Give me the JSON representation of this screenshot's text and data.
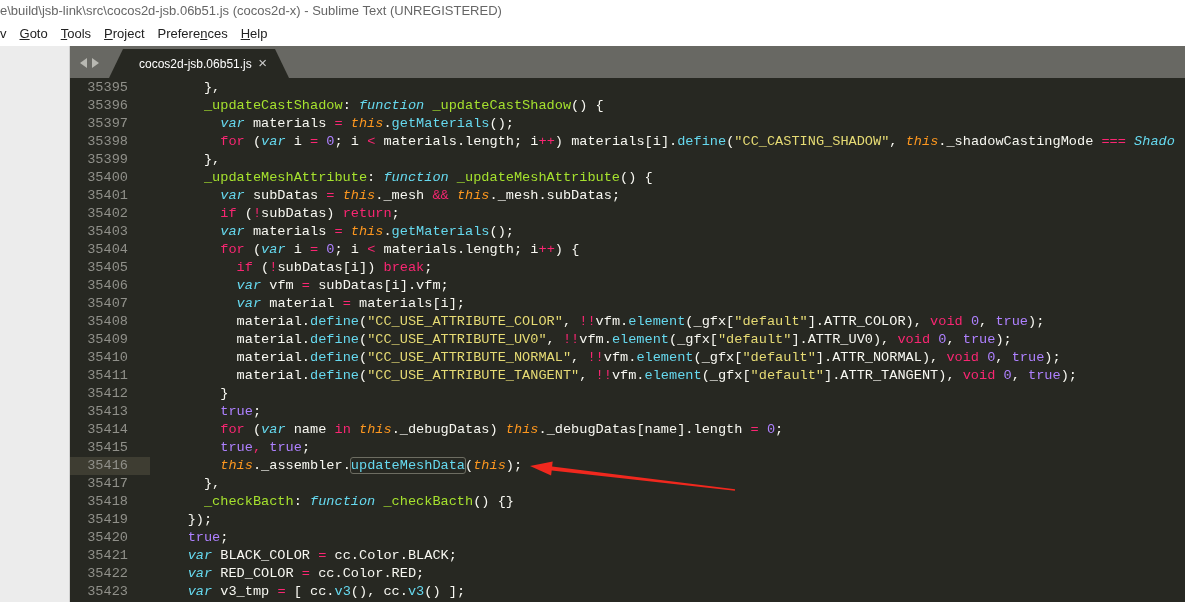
{
  "window": {
    "title": "e\\build\\jsb-link\\src\\cocos2d-jsb.06b51.js (cocos2d-x) - Sublime Text (UNREGISTERED)"
  },
  "menu": [
    {
      "before": "v"
    },
    {
      "key": "G",
      "after": "oto"
    },
    {
      "key": "T",
      "after": "ools"
    },
    {
      "key": "P",
      "after": "roject"
    },
    {
      "before": "Prefere",
      "key": "n",
      "after": "ces"
    },
    {
      "key": "H",
      "after": "elp"
    }
  ],
  "tabs": [
    {
      "label": "cocos2d-jsb.06b51.js",
      "selected": true,
      "close": "×"
    }
  ],
  "lines": [
    {
      "number": "35395",
      "current": false,
      "tokens": [
        {
          "kind": "p",
          "text": "      },"
        }
      ]
    },
    {
      "number": "35396",
      "current": false,
      "tokens": [
        {
          "kind": "en",
          "text": "      _updateCastShadow"
        },
        {
          "kind": "p",
          "text": ": "
        },
        {
          "kind": "st",
          "text": "function "
        },
        {
          "kind": "en",
          "text": "_updateCastShadow"
        },
        {
          "kind": "p",
          "text": "() {"
        }
      ]
    },
    {
      "number": "35397",
      "current": false,
      "tokens": [
        {
          "kind": "st",
          "text": "        var"
        },
        {
          "kind": "p",
          "text": " materials "
        },
        {
          "kind": "kw",
          "text": "= "
        },
        {
          "kind": "th",
          "text": "this"
        },
        {
          "kind": "p",
          "text": "."
        },
        {
          "kind": "fn",
          "text": "getMaterials"
        },
        {
          "kind": "p",
          "text": "();"
        }
      ]
    },
    {
      "number": "35398",
      "current": false,
      "tokens": [
        {
          "kind": "kw",
          "text": "        for"
        },
        {
          "kind": "p",
          "text": " ("
        },
        {
          "kind": "st",
          "text": "var"
        },
        {
          "kind": "p",
          "text": " i "
        },
        {
          "kind": "kw",
          "text": "= "
        },
        {
          "kind": "num",
          "text": "0"
        },
        {
          "kind": "p",
          "text": "; i "
        },
        {
          "kind": "kw",
          "text": "<"
        },
        {
          "kind": "p",
          "text": " materials.length; i"
        },
        {
          "kind": "kw",
          "text": "++"
        },
        {
          "kind": "p",
          "text": ") materials[i]."
        },
        {
          "kind": "fn",
          "text": "define"
        },
        {
          "kind": "p",
          "text": "("
        },
        {
          "kind": "str",
          "text": "\"CC_CASTING_SHADOW\""
        },
        {
          "kind": "p",
          "text": ", "
        },
        {
          "kind": "th",
          "text": "this"
        },
        {
          "kind": "p",
          "text": "._shadowCastingMode "
        },
        {
          "kind": "kw",
          "text": "=== "
        },
        {
          "kind": "st",
          "text": "Shado"
        }
      ]
    },
    {
      "number": "35399",
      "current": false,
      "tokens": [
        {
          "kind": "p",
          "text": "      },"
        }
      ]
    },
    {
      "number": "35400",
      "current": false,
      "tokens": [
        {
          "kind": "en",
          "text": "      _updateMeshAttribute"
        },
        {
          "kind": "p",
          "text": ": "
        },
        {
          "kind": "st",
          "text": "function "
        },
        {
          "kind": "en",
          "text": "_updateMeshAttribute"
        },
        {
          "kind": "p",
          "text": "() {"
        }
      ]
    },
    {
      "number": "35401",
      "current": false,
      "tokens": [
        {
          "kind": "st",
          "text": "        var"
        },
        {
          "kind": "p",
          "text": " subDatas "
        },
        {
          "kind": "kw",
          "text": "= "
        },
        {
          "kind": "th",
          "text": "this"
        },
        {
          "kind": "p",
          "text": "._mesh "
        },
        {
          "kind": "kw",
          "text": "&& "
        },
        {
          "kind": "th",
          "text": "this"
        },
        {
          "kind": "p",
          "text": "._mesh.subDatas;"
        }
      ]
    },
    {
      "number": "35402",
      "current": false,
      "tokens": [
        {
          "kind": "kw",
          "text": "        if"
        },
        {
          "kind": "p",
          "text": " ("
        },
        {
          "kind": "kw",
          "text": "!"
        },
        {
          "kind": "p",
          "text": "subDatas) "
        },
        {
          "kind": "kw",
          "text": "return"
        },
        {
          "kind": "p",
          "text": ";"
        }
      ]
    },
    {
      "number": "35403",
      "current": false,
      "tokens": [
        {
          "kind": "st",
          "text": "        var"
        },
        {
          "kind": "p",
          "text": " materials "
        },
        {
          "kind": "kw",
          "text": "= "
        },
        {
          "kind": "th",
          "text": "this"
        },
        {
          "kind": "p",
          "text": "."
        },
        {
          "kind": "fn",
          "text": "getMaterials"
        },
        {
          "kind": "p",
          "text": "();"
        }
      ]
    },
    {
      "number": "35404",
      "current": false,
      "tokens": [
        {
          "kind": "kw",
          "text": "        for"
        },
        {
          "kind": "p",
          "text": " ("
        },
        {
          "kind": "st",
          "text": "var"
        },
        {
          "kind": "p",
          "text": " i "
        },
        {
          "kind": "kw",
          "text": "= "
        },
        {
          "kind": "num",
          "text": "0"
        },
        {
          "kind": "p",
          "text": "; i "
        },
        {
          "kind": "kw",
          "text": "<"
        },
        {
          "kind": "p",
          "text": " materials.length; i"
        },
        {
          "kind": "kw",
          "text": "++"
        },
        {
          "kind": "p",
          "text": ") {"
        }
      ]
    },
    {
      "number": "35405",
      "current": false,
      "tokens": [
        {
          "kind": "kw",
          "text": "          if"
        },
        {
          "kind": "p",
          "text": " ("
        },
        {
          "kind": "kw",
          "text": "!"
        },
        {
          "kind": "p",
          "text": "subDatas[i]) "
        },
        {
          "kind": "kw",
          "text": "break"
        },
        {
          "kind": "p",
          "text": ";"
        }
      ]
    },
    {
      "number": "35406",
      "current": false,
      "tokens": [
        {
          "kind": "st",
          "text": "          var"
        },
        {
          "kind": "p",
          "text": " vfm "
        },
        {
          "kind": "kw",
          "text": "="
        },
        {
          "kind": "p",
          "text": " subDatas[i].vfm;"
        }
      ]
    },
    {
      "number": "35407",
      "current": false,
      "tokens": [
        {
          "kind": "st",
          "text": "          var"
        },
        {
          "kind": "p",
          "text": " material "
        },
        {
          "kind": "kw",
          "text": "="
        },
        {
          "kind": "p",
          "text": " materials[i];"
        }
      ]
    },
    {
      "number": "35408",
      "current": false,
      "tokens": [
        {
          "kind": "p",
          "text": "          material."
        },
        {
          "kind": "fn",
          "text": "define"
        },
        {
          "kind": "p",
          "text": "("
        },
        {
          "kind": "str",
          "text": "\"CC_USE_ATTRIBUTE_COLOR\""
        },
        {
          "kind": "p",
          "text": ", "
        },
        {
          "kind": "kw",
          "text": "!!"
        },
        {
          "kind": "p",
          "text": "vfm."
        },
        {
          "kind": "fn",
          "text": "element"
        },
        {
          "kind": "p",
          "text": "(_gfx["
        },
        {
          "kind": "str",
          "text": "\"default\""
        },
        {
          "kind": "p",
          "text": "].ATTR_COLOR), "
        },
        {
          "kind": "kw",
          "text": "void "
        },
        {
          "kind": "num",
          "text": "0"
        },
        {
          "kind": "p",
          "text": ", "
        },
        {
          "kind": "num",
          "text": "true"
        },
        {
          "kind": "p",
          "text": ");"
        }
      ]
    },
    {
      "number": "35409",
      "current": false,
      "tokens": [
        {
          "kind": "p",
          "text": "          material."
        },
        {
          "kind": "fn",
          "text": "define"
        },
        {
          "kind": "p",
          "text": "("
        },
        {
          "kind": "str",
          "text": "\"CC_USE_ATTRIBUTE_UV0\""
        },
        {
          "kind": "p",
          "text": ", "
        },
        {
          "kind": "kw",
          "text": "!!"
        },
        {
          "kind": "p",
          "text": "vfm."
        },
        {
          "kind": "fn",
          "text": "element"
        },
        {
          "kind": "p",
          "text": "(_gfx["
        },
        {
          "kind": "str",
          "text": "\"default\""
        },
        {
          "kind": "p",
          "text": "].ATTR_UV0), "
        },
        {
          "kind": "kw",
          "text": "void "
        },
        {
          "kind": "num",
          "text": "0"
        },
        {
          "kind": "p",
          "text": ", "
        },
        {
          "kind": "num",
          "text": "true"
        },
        {
          "kind": "p",
          "text": ");"
        }
      ]
    },
    {
      "number": "35410",
      "current": false,
      "tokens": [
        {
          "kind": "p",
          "text": "          material."
        },
        {
          "kind": "fn",
          "text": "define"
        },
        {
          "kind": "p",
          "text": "("
        },
        {
          "kind": "str",
          "text": "\"CC_USE_ATTRIBUTE_NORMAL\""
        },
        {
          "kind": "p",
          "text": ", "
        },
        {
          "kind": "kw",
          "text": "!!"
        },
        {
          "kind": "p",
          "text": "vfm."
        },
        {
          "kind": "fn",
          "text": "element"
        },
        {
          "kind": "p",
          "text": "(_gfx["
        },
        {
          "kind": "str",
          "text": "\"default\""
        },
        {
          "kind": "p",
          "text": "].ATTR_NORMAL), "
        },
        {
          "kind": "kw",
          "text": "void "
        },
        {
          "kind": "num",
          "text": "0"
        },
        {
          "kind": "p",
          "text": ", "
        },
        {
          "kind": "num",
          "text": "true"
        },
        {
          "kind": "p",
          "text": ");"
        }
      ]
    },
    {
      "number": "35411",
      "current": false,
      "tokens": [
        {
          "kind": "p",
          "text": "          material."
        },
        {
          "kind": "fn",
          "text": "define"
        },
        {
          "kind": "p",
          "text": "("
        },
        {
          "kind": "str",
          "text": "\"CC_USE_ATTRIBUTE_TANGENT\""
        },
        {
          "kind": "p",
          "text": ", "
        },
        {
          "kind": "kw",
          "text": "!!"
        },
        {
          "kind": "p",
          "text": "vfm."
        },
        {
          "kind": "fn",
          "text": "element"
        },
        {
          "kind": "p",
          "text": "(_gfx["
        },
        {
          "kind": "str",
          "text": "\"default\""
        },
        {
          "kind": "p",
          "text": "].ATTR_TANGENT), "
        },
        {
          "kind": "kw",
          "text": "void "
        },
        {
          "kind": "num",
          "text": "0"
        },
        {
          "kind": "p",
          "text": ", "
        },
        {
          "kind": "num",
          "text": "true"
        },
        {
          "kind": "p",
          "text": ");"
        }
      ]
    },
    {
      "number": "35412",
      "current": false,
      "tokens": [
        {
          "kind": "p",
          "text": "        }"
        }
      ]
    },
    {
      "number": "35413",
      "current": false,
      "tokens": [
        {
          "kind": "num",
          "text": "        true"
        },
        {
          "kind": "p",
          "text": ";"
        }
      ]
    },
    {
      "number": "35414",
      "current": false,
      "tokens": [
        {
          "kind": "kw",
          "text": "        for"
        },
        {
          "kind": "p",
          "text": " ("
        },
        {
          "kind": "st",
          "text": "var"
        },
        {
          "kind": "p",
          "text": " name "
        },
        {
          "kind": "kw",
          "text": "in "
        },
        {
          "kind": "th",
          "text": "this"
        },
        {
          "kind": "p",
          "text": "._debugDatas) "
        },
        {
          "kind": "th",
          "text": "this"
        },
        {
          "kind": "p",
          "text": "._debugDatas[name].length "
        },
        {
          "kind": "kw",
          "text": "= "
        },
        {
          "kind": "num",
          "text": "0"
        },
        {
          "kind": "p",
          "text": ";"
        }
      ]
    },
    {
      "number": "35415",
      "current": false,
      "tokens": [
        {
          "kind": "num",
          "text": "        true"
        },
        {
          "kind": "kw",
          "text": ", "
        },
        {
          "kind": "num",
          "text": "true"
        },
        {
          "kind": "p",
          "text": ";"
        }
      ]
    },
    {
      "number": "35416",
      "current": true,
      "tokens": [
        {
          "kind": "th",
          "text": "        this"
        },
        {
          "kind": "p",
          "text": "._assembler."
        },
        {
          "kind": "match",
          "text": "updateMeshData"
        },
        {
          "kind": "p",
          "text": "("
        },
        {
          "kind": "th",
          "text": "this"
        },
        {
          "kind": "p",
          "text": ");"
        }
      ]
    },
    {
      "number": "35417",
      "current": false,
      "tokens": [
        {
          "kind": "p",
          "text": "      },"
        }
      ]
    },
    {
      "number": "35418",
      "current": false,
      "tokens": [
        {
          "kind": "en",
          "text": "      _checkBacth"
        },
        {
          "kind": "p",
          "text": ": "
        },
        {
          "kind": "st",
          "text": "function "
        },
        {
          "kind": "en",
          "text": "_checkBacth"
        },
        {
          "kind": "p",
          "text": "() {}"
        }
      ]
    },
    {
      "number": "35419",
      "current": false,
      "tokens": [
        {
          "kind": "p",
          "text": "    });"
        }
      ]
    },
    {
      "number": "35420",
      "current": false,
      "tokens": [
        {
          "kind": "num",
          "text": "    true"
        },
        {
          "kind": "p",
          "text": ";"
        }
      ]
    },
    {
      "number": "35421",
      "current": false,
      "tokens": [
        {
          "kind": "st",
          "text": "    var"
        },
        {
          "kind": "p",
          "text": " BLACK_COLOR "
        },
        {
          "kind": "kw",
          "text": "="
        },
        {
          "kind": "p",
          "text": " cc.Color.BLACK;"
        }
      ]
    },
    {
      "number": "35422",
      "current": false,
      "tokens": [
        {
          "kind": "st",
          "text": "    var"
        },
        {
          "kind": "p",
          "text": " RED_COLOR "
        },
        {
          "kind": "kw",
          "text": "="
        },
        {
          "kind": "p",
          "text": " cc.Color.RED;"
        }
      ]
    },
    {
      "number": "35423",
      "current": false,
      "tokens": [
        {
          "kind": "st",
          "text": "    var"
        },
        {
          "kind": "p",
          "text": " v3_tmp "
        },
        {
          "kind": "kw",
          "text": "="
        },
        {
          "kind": "p",
          "text": " [ cc."
        },
        {
          "kind": "fn",
          "text": "v3"
        },
        {
          "kind": "p",
          "text": "(), cc."
        },
        {
          "kind": "fn",
          "text": "v3"
        },
        {
          "kind": "p",
          "text": "() ];"
        }
      ]
    }
  ]
}
